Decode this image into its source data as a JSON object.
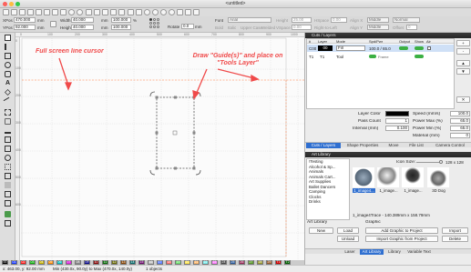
{
  "window": {
    "title": "<untitled>"
  },
  "toolbar1": {
    "xpos_label": "XPos",
    "xpos_value": "470.000",
    "mm1": "mm",
    "ypos_label": "YPos",
    "ypos_value": "92.000",
    "mm2": "mm",
    "width_label": "Width",
    "width_value": "40.000",
    "mm3": "mm",
    "height_label": "Height",
    "height_value": "40.000",
    "mm4": "mm",
    "pct_w": "100.000",
    "pct_h": "100.000",
    "pct": "%",
    "rotate_label": "Rotate",
    "rotate_value": "0.0",
    "mm5": "mm",
    "font_label": "Font",
    "font_value": "Arial",
    "height2_label": "Height",
    "height2_value": "25.00",
    "hspace_label": "HSpace",
    "hspace_value": "0.00",
    "vspace_label": "VSpace",
    "vspace_value": "0.00",
    "align_x_label": "Align X",
    "align_x_value": "Middle",
    "align_y_label": "Align Y",
    "align_y_value": "Middle",
    "offset_label": "Offset",
    "offset_value": "0",
    "normal": "Normal",
    "bold": "Bold",
    "italic": "Italic",
    "upper": "Upper Case",
    "welded": "Welded",
    "distort": "Distort",
    "zero_weld": "Zero Weld",
    "dig_dense": "Dig Dense",
    "right_label": "Right-to-Left",
    "cage": "Cage"
  },
  "annotations": {
    "cursor_note": "Full screen line cursor",
    "guide_note": "Draw \"Guide(s)\" and place on \"Tools Layer\""
  },
  "rulers": {
    "top": [
      "0",
      "100",
      "200",
      "300",
      "400",
      "500",
      "600",
      "700",
      "800",
      "900",
      "1000"
    ],
    "left": [
      "0",
      "100",
      "200",
      "300",
      "400",
      "500",
      "600"
    ]
  },
  "palette": [
    "00",
    "01",
    "02",
    "03",
    "04",
    "05",
    "06",
    "07",
    "08",
    "09",
    "10",
    "11",
    "12",
    "13",
    "14",
    "15",
    "16",
    "17",
    "18",
    "19",
    "20",
    "21",
    "22",
    "23",
    "24",
    "25",
    "26",
    "27",
    "28",
    "29",
    "T1",
    "T2"
  ],
  "palette_colors": [
    "#000000",
    "#1a3bff",
    "#ff1a1a",
    "#0fb30f",
    "#c8b400",
    "#ff8c00",
    "#00c0c0",
    "#e020e0",
    "#8a8a8a",
    "#0a0a8c",
    "#8c0a0a",
    "#0a6e0a",
    "#6e6e0a",
    "#8c4a0a",
    "#0a6e6e",
    "#6e0a6e",
    "#c0c0c0",
    "#5a7dff",
    "#ff6a6a",
    "#6adf6a",
    "#ffe64a",
    "#ffb86a",
    "#7af0f0",
    "#ff7aff",
    "#4a4a4a",
    "#2a5a9a",
    "#9a2a5a",
    "#5a9a2a",
    "#9a9a2a",
    "#9a5a2a",
    "#d00000",
    "#006000"
  ],
  "status": {
    "coords": "x: 463.00, y: 92.00 mm",
    "range": "Min (430.0x, 90.0y) to Max (470.0x, 140.0y)",
    "objects": "1 objects"
  },
  "cuts_layers": {
    "title": "Cuts / Layers",
    "headers": [
      "#",
      "Layer",
      "Mode",
      "Spd/Pwr",
      "Output",
      "Show",
      "Air"
    ],
    "rows": [
      {
        "num": "C00",
        "layer": "00",
        "mode": "Fill",
        "spd": "100.0 / 65.0"
      },
      {
        "num": "T1",
        "layer": "T1",
        "mode": "Tool",
        "spd": ""
      }
    ],
    "side_buttons": [
      "+",
      "-",
      "▲",
      "▼",
      "✕"
    ],
    "layer_color_label": "Layer Color",
    "speed_label": "Speed (mm/s)",
    "speed_value": "100.0",
    "pass_count_label": "Pass Count",
    "pass_count_value": "1",
    "max_power_label": "Power Max (%)",
    "max_power_value": "65.0",
    "interval_label": "Interval (mm)",
    "interval_value": "0.100",
    "min_power_label": "Power Min (%)",
    "min_power_value": "65.0",
    "material_label": "Material (mm)",
    "material_value": "0",
    "tabs": [
      "Cuts / Layers",
      "Shape Properties",
      "Move",
      "File List",
      "Camera Control"
    ]
  },
  "art_library": {
    "title": "Art Library",
    "list": [
      "!Testing",
      "Alcohol & Sp...",
      "Animals",
      "Animals Cart...",
      "Art Supplies",
      "Ballet Dancers",
      "Camping",
      "Clocks",
      "Drinks"
    ],
    "icon_size_label": "Icon Size:",
    "icon_size_value": "128 x 128",
    "thumbs": [
      "1_image4...",
      "1_image...",
      "1_image...",
      "3D Dog"
    ],
    "caption": "1_image4Trace - 140.389mm x 158.79mm",
    "section_art": "Art Library",
    "section_graphic": "Graphic",
    "buttons": {
      "new": "New",
      "load": "Load",
      "unload": "Unload",
      "add_graphic": "Add Graphic to Project",
      "import_graphic": "Import Graphic from Project",
      "import": "Import",
      "delete": "Delete"
    },
    "bottom_tabs": [
      "Laser",
      "Art Library",
      "Library",
      "Variable Text"
    ]
  }
}
